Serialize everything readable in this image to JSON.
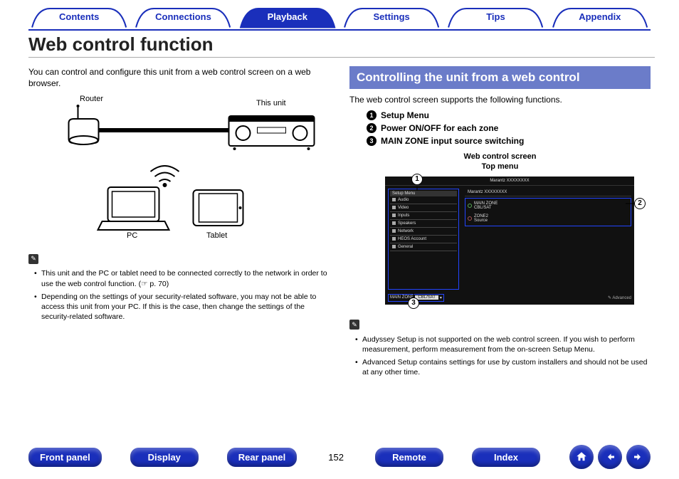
{
  "topNav": {
    "tabs": [
      {
        "label": "Contents"
      },
      {
        "label": "Connections"
      },
      {
        "label": "Playback"
      },
      {
        "label": "Settings"
      },
      {
        "label": "Tips"
      },
      {
        "label": "Appendix"
      }
    ]
  },
  "pageTitle": "Web control function",
  "intro": "You can control and configure this unit from a web control screen on a web browser.",
  "diagram": {
    "router": "Router",
    "thisUnit": "This unit",
    "pc": "PC",
    "tablet": "Tablet"
  },
  "leftNotes": [
    "This unit and the PC or tablet need to be connected correctly to the network in order to use the web control function. (☞ p. 70)",
    "Depending on the settings of your security-related software, you may not be able to access this unit from your PC. If this is the case, then change the settings of the security-related software."
  ],
  "sectionHeader": "Controlling the unit from a web control",
  "featureIntro": "The web control screen supports the following functions.",
  "features": [
    "Setup Menu",
    "Power ON/OFF for each zone",
    "MAIN ZONE input source switching"
  ],
  "screenCaption1": "Web control screen",
  "screenCaption2": "Top menu",
  "mock": {
    "brand": "Marantz XXXXXXXX",
    "setupMenu": "Setup Menu",
    "sideItems": [
      "Audio",
      "Video",
      "Inputs",
      "Speakers",
      "Network",
      "HEOS Account",
      "General"
    ],
    "deviceName": "Marantz XXXXXXXX",
    "mainZone": "MAIN ZONE",
    "mainSource": "CBL/SAT",
    "zone2": "ZONE2",
    "zone2Source": "Source",
    "zoneSelLabel": "MAIN ZONE",
    "zoneSelValue": "CBL/SAT",
    "advanced": "Advanced"
  },
  "rightNotes": [
    "Audyssey Setup is not supported on the web control screen. If you wish to perform measurement, perform measurement from the on-screen Setup Menu.",
    "Advanced Setup contains settings for use by custom installers and should not be used at any other time."
  ],
  "bottomNav": {
    "buttons": [
      "Front panel",
      "Display",
      "Rear panel"
    ],
    "pageNumber": "152",
    "buttons2": [
      "Remote",
      "Index"
    ]
  }
}
